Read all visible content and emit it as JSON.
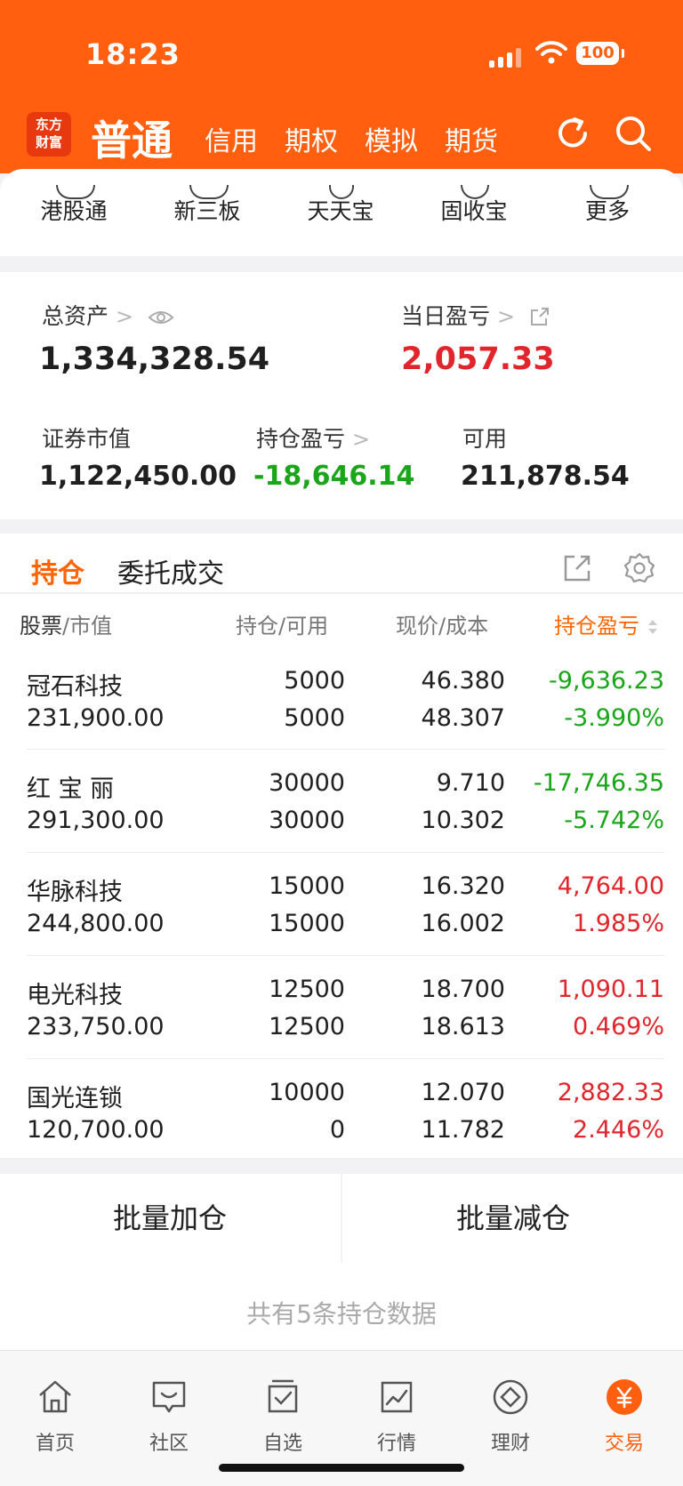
{
  "status": {
    "time": "18:23",
    "battery": "100"
  },
  "nav": {
    "logo_line1": "东方",
    "logo_line2": "财富",
    "main": "普通",
    "tabs": [
      "信用",
      "期权",
      "模拟",
      "期货"
    ]
  },
  "shortcuts": [
    "港股通",
    "新三板",
    "天天宝",
    "固收宝",
    "更多"
  ],
  "assets": {
    "total_label": "总资产",
    "total_value": "1,334,328.54",
    "daily_label": "当日盈亏",
    "daily_value": "2,057.33",
    "market_label": "证券市值",
    "market_value": "1,122,450.00",
    "holding_pl_label": "持仓盈亏",
    "holding_pl_value": "-18,646.14",
    "available_label": "可用",
    "available_value": "211,878.54"
  },
  "positions": {
    "tab_holdings": "持仓",
    "tab_orders": "委托成交",
    "headers": {
      "stock": "股票",
      "mv": "市值",
      "hold": "持仓",
      "avail": "可用",
      "price": "现价",
      "cost": "成本",
      "pl": "持仓盈亏"
    },
    "rows": [
      {
        "name": "冠石科技",
        "mv": "231,900.00",
        "hold": "5000",
        "avail": "5000",
        "price": "46.380",
        "cost": "48.307",
        "pl": "-9,636.23",
        "pct": "-3.990%"
      },
      {
        "name": "红 宝 丽",
        "mv": "291,300.00",
        "hold": "30000",
        "avail": "30000",
        "price": "9.710",
        "cost": "10.302",
        "pl": "-17,746.35",
        "pct": "-5.742%"
      },
      {
        "name": "华脉科技",
        "mv": "244,800.00",
        "hold": "15000",
        "avail": "15000",
        "price": "16.320",
        "cost": "16.002",
        "pl": "4,764.00",
        "pct": "1.985%"
      },
      {
        "name": "电光科技",
        "mv": "233,750.00",
        "hold": "12500",
        "avail": "12500",
        "price": "18.700",
        "cost": "18.613",
        "pl": "1,090.11",
        "pct": "0.469%"
      },
      {
        "name": "国光连锁",
        "mv": "120,700.00",
        "hold": "10000",
        "avail": "0",
        "price": "12.070",
        "cost": "11.782",
        "pl": "2,882.33",
        "pct": "2.446%"
      }
    ]
  },
  "batch": {
    "add": "批量加仓",
    "reduce": "批量减仓"
  },
  "footer": {
    "count_text": "共有5条持仓数据"
  },
  "tabbar": [
    "首页",
    "社区",
    "自选",
    "行情",
    "理财",
    "交易"
  ],
  "colors": {
    "brand": "#ff5f0f",
    "up": "#e0262c",
    "down": "#1aa51a"
  }
}
